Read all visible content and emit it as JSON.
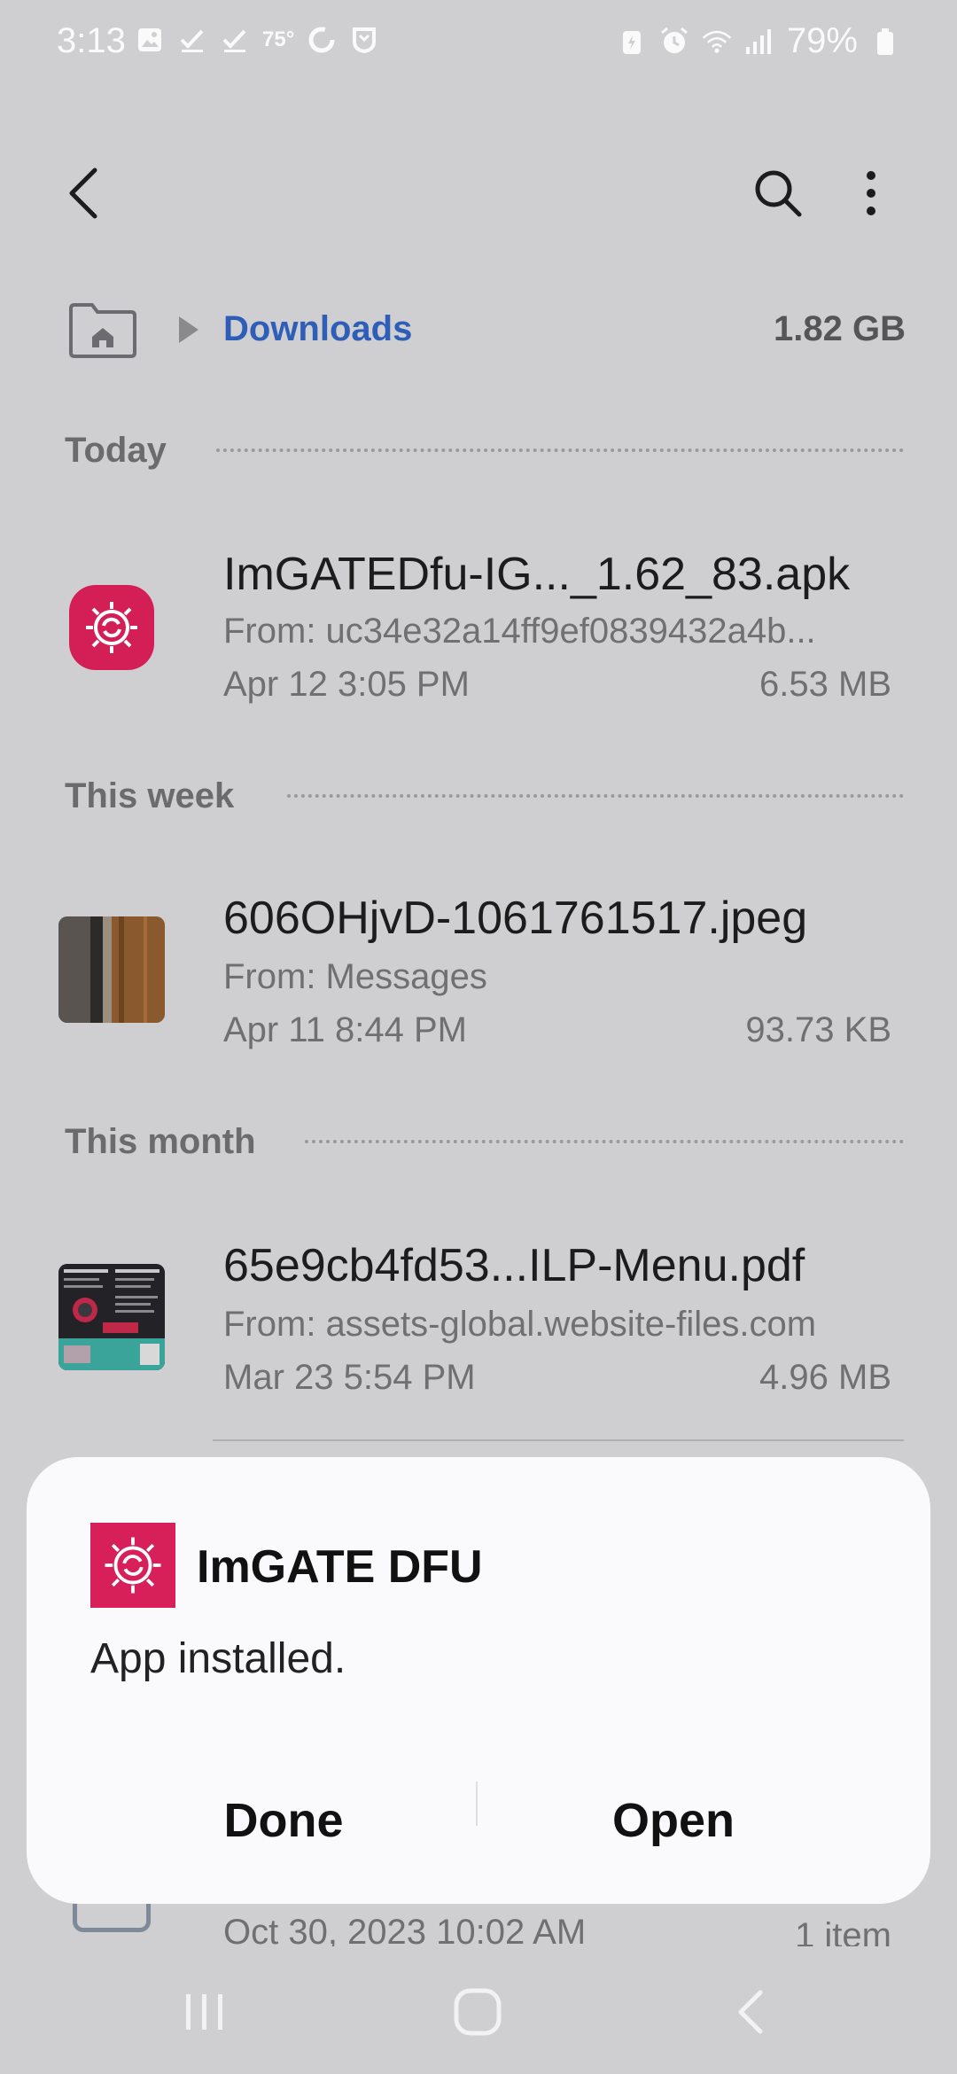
{
  "status_bar": {
    "time": "3:13",
    "temperature": "75°",
    "battery_percent": "79%",
    "icons_left": [
      "gallery-icon",
      "check-icon",
      "check-icon",
      "temperature-text",
      "sync-icon",
      "shield-app-icon"
    ],
    "icons_right": [
      "battery-saver-icon",
      "alarm-icon",
      "wifi-icon",
      "signal-icon",
      "battery-icon"
    ]
  },
  "app_bar": {
    "back_icon": "chevron-left-icon",
    "search_icon": "search-icon",
    "more_icon": "more-vertical-icon"
  },
  "breadcrumb": {
    "home_icon": "home-folder-icon",
    "current": "Downloads",
    "storage": "1.82 GB"
  },
  "sections": [
    {
      "header": "Today",
      "files": [
        {
          "name": "ImGATEDfu-IG..._1.62_83.apk",
          "from": "From: uc34e32a14ff9ef0839432a4b...",
          "date": "Apr 12 3:05 PM",
          "size": "6.53 MB",
          "thumb": "apk-settings-icon"
        }
      ]
    },
    {
      "header": "This week",
      "files": [
        {
          "name": "606OHjvD-1061761517.jpeg",
          "from": "From: Messages",
          "date": "Apr 11 8:44 PM",
          "size": "93.73 KB",
          "thumb": "image-thumbnail"
        }
      ]
    },
    {
      "header": "This month",
      "files": [
        {
          "name": "65e9cb4fd53...ILP-Menu.pdf",
          "from": "From: assets-global.website-files.com",
          "date": "Mar 23 5:54 PM",
          "size": "4.96 MB",
          "thumb": "pdf-thumbnail"
        }
      ]
    }
  ],
  "hidden_row": {
    "date": "Oct 30, 2023 10:02 AM",
    "count": "1 item"
  },
  "dialog": {
    "app_name": "ImGATE DFU",
    "message": "App installed.",
    "done_label": "Done",
    "open_label": "Open",
    "app_icon": "settings-sync-icon",
    "accent_color": "#d71f5a"
  },
  "nav_bar": {
    "recents_icon": "recents-icon",
    "home_icon": "home-circle-icon",
    "back_icon": "back-icon"
  }
}
